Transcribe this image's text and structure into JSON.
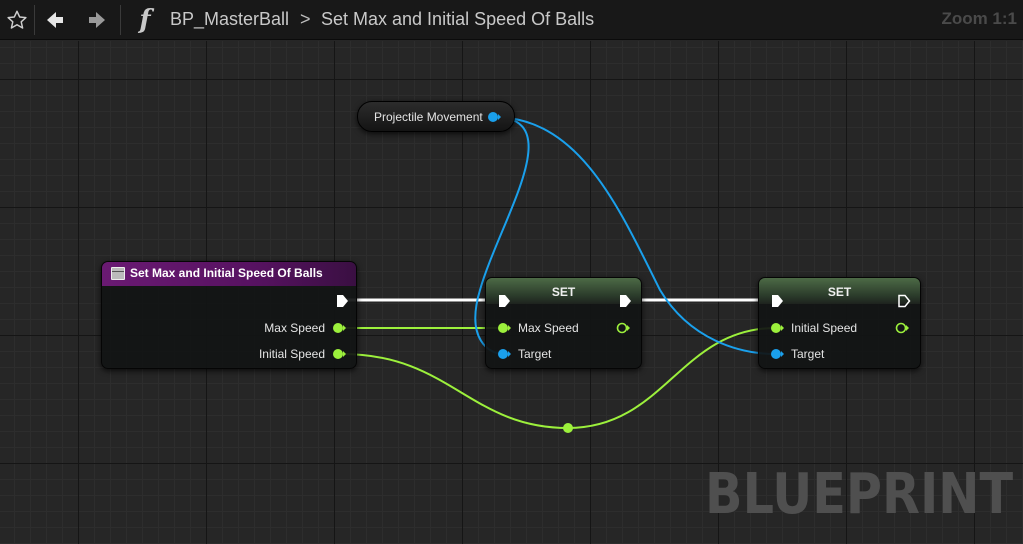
{
  "toolbar": {
    "favorite_icon": "star-outline-icon",
    "back_icon": "arrow-left-icon",
    "forward_icon": "arrow-right-icon",
    "function_icon": "function-icon",
    "function_glyph": "f",
    "breadcrumb": {
      "blueprint": "BP_MasterBall",
      "separator": ">",
      "function": "Set Max and Initial Speed Of Balls"
    },
    "zoom": "Zoom 1:1"
  },
  "graph": {
    "watermark": "BLUEPRINT",
    "nodes": {
      "projectile_movement": {
        "label": "Projectile Movement",
        "pin_color": "#1aa0ec"
      },
      "function_entry": {
        "title": "Set Max and Initial Speed Of Balls",
        "header_color": "#6a1a73",
        "pins": [
          "Max Speed",
          "Initial Speed"
        ]
      },
      "set_max_speed": {
        "title": "SET",
        "pins": {
          "value": "Max Speed",
          "target": "Target"
        }
      },
      "set_initial_speed": {
        "title": "SET",
        "pins": {
          "value": "Initial Speed",
          "target": "Target"
        }
      }
    },
    "colors": {
      "exec": "#ffffff",
      "float": "#9cf03c",
      "object": "#1aa0ec"
    }
  }
}
